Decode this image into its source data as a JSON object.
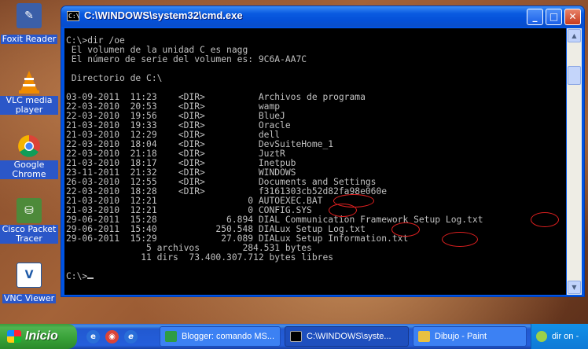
{
  "desktop": {
    "icons": [
      {
        "label": "Foxit Reader",
        "icon": "foxit-reader-icon",
        "color": "#3b5fa8"
      },
      {
        "label": "VLC media player",
        "icon": "vlc-cone-icon",
        "color": "#f08c00"
      },
      {
        "label": "Google Chrome",
        "icon": "chrome-icon",
        "color": "#2e9c44"
      },
      {
        "label": "Cisco Packet Tracer",
        "icon": "packet-tracer-icon",
        "color": "#4d8a3a"
      },
      {
        "label": "VNC Viewer",
        "icon": "vnc-viewer-icon",
        "color": "#1e5aa8"
      }
    ]
  },
  "window": {
    "title": "C:\\WINDOWS\\system32\\cmd.exe",
    "minimize_glyph": "_",
    "maximize_glyph": "□",
    "close_glyph": "✕"
  },
  "console": {
    "lines": [
      "C:\\>dir /oe",
      " El volumen de la unidad C es nagg",
      " El número de serie del volumen es: 9C6A-AA7C",
      "",
      " Directorio de C:\\",
      "",
      "03-09-2011  11:23    <DIR>          Archivos de programa",
      "22-03-2010  20:53    <DIR>          wamp",
      "22-03-2010  19:56    <DIR>          BlueJ",
      "21-03-2010  19:33    <DIR>          Oracle",
      "21-03-2010  12:29    <DIR>          dell",
      "22-03-2010  18:04    <DIR>          DevSuiteHome_1",
      "22-03-2010  21:18    <DIR>          JuztR",
      "21-03-2010  18:17    <DIR>          Inetpub",
      "23-11-2011  21:32    <DIR>          WINDOWS",
      "26-03-2010  12:55    <DIR>          Documents and Settings",
      "22-03-2010  18:28    <DIR>          f3161303cb52d82fa98e060e",
      "21-03-2010  12:21                 0 AUTOEXEC.BAT",
      "21-03-2010  12:21                 0 CONFIG.SYS",
      "29-06-2011  15:28             6.894 DIAL Communication Framework Setup Log.txt",
      "29-06-2011  15:40           250.548 DIALux Setup Log.txt",
      "29-06-2011  15:29            27.089 DIALux Setup Information.txt",
      "               5 archivos        284.531 bytes",
      "              11 dirs  73.400.307.712 bytes libres",
      "",
      "C:\\>"
    ]
  },
  "taskbar": {
    "start_label": "Inicio",
    "tasks": [
      {
        "label": "Blogger: comando MS...",
        "icon": "chrome-icon",
        "color": "#2e9c44",
        "active": false
      },
      {
        "label": "C:\\WINDOWS\\syste...",
        "icon": "cmd-icon",
        "color": "#000000",
        "active": true
      },
      {
        "label": "Dibujo - Paint",
        "icon": "paint-icon",
        "color": "#e8c040",
        "active": false
      }
    ],
    "tray_label": "dir on -"
  },
  "colors": {
    "annotation": "#e02020",
    "console_text": "#c0c0c0",
    "console_bg": "#000000"
  }
}
